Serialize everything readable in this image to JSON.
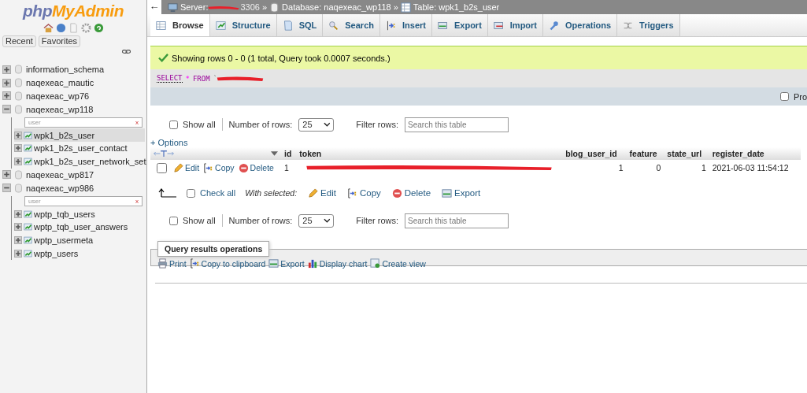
{
  "sidebar": {
    "logo": {
      "part_1": "php",
      "part_2": "MyAdmin"
    },
    "tabs": [
      {
        "label": "Recent"
      },
      {
        "label": "Favorites"
      }
    ],
    "databases": [
      {
        "name": "information_schema",
        "expanded": false
      },
      {
        "name": "naqexeac_mautic",
        "expanded": false
      },
      {
        "name": "naqexeac_wp76",
        "expanded": false
      },
      {
        "name": "naqexeac_wp118",
        "expanded": true,
        "filter": {
          "value": "user",
          "clear": "x"
        },
        "children": [
          {
            "name": "wpk1_b2s_user",
            "selected": true
          },
          {
            "name": "wpk1_b2s_user_contact",
            "selected": false
          },
          {
            "name": "wpk1_b2s_user_network_set",
            "selected": false
          }
        ]
      },
      {
        "name": "naqexeac_wp817",
        "expanded": false
      },
      {
        "name": "naqexeac_wp986",
        "expanded": true,
        "filter": {
          "value": "user",
          "clear": "x"
        },
        "children": [
          {
            "name": "wptp_tqb_users",
            "selected": false
          },
          {
            "name": "wptp_tqb_user_answers",
            "selected": false
          },
          {
            "name": "wptp_usermeta",
            "selected": false
          },
          {
            "name": "wptp_users",
            "selected": false
          }
        ]
      }
    ]
  },
  "breadcrumb": {
    "back": "←",
    "server_label": "Server:",
    "server_tail": "3306",
    "sep_1": "»",
    "database": "Database: naqexeac_wp118",
    "sep_2": "»",
    "table": "Table: wpk1_b2s_user"
  },
  "tabs": [
    {
      "label": "Browse",
      "selected": true
    },
    {
      "label": "Structure",
      "selected": false
    },
    {
      "label": "SQL",
      "selected": false
    },
    {
      "label": "Search",
      "selected": false
    },
    {
      "label": "Insert",
      "selected": false
    },
    {
      "label": "Export",
      "selected": false
    },
    {
      "label": "Import",
      "selected": false
    },
    {
      "label": "Operations",
      "selected": false
    },
    {
      "label": "Triggers",
      "selected": false
    }
  ],
  "message": "Showing rows 0 - 0 (1 total, Query took 0.0007 seconds.)",
  "sql": {
    "keyword_1": "SELECT",
    "star": "*",
    "keyword_2": "FROM",
    "quote": "`"
  },
  "profiling": {
    "label": "Pro",
    "checked": false
  },
  "navigation": [
    {
      "show_all": "Show all",
      "checked": false,
      "rows_label": "Number of rows:",
      "rows_value": "25",
      "filter_label": "Filter rows:",
      "filter_placeholder": "Search this table"
    },
    {
      "show_all": "Show all",
      "checked": false,
      "rows_label": "Number of rows:",
      "rows_value": "25",
      "filter_label": "Filter rows:",
      "filter_placeholder": "Search this table"
    }
  ],
  "options": "+ Options",
  "table": {
    "columns": [
      "id",
      "token",
      "blog_user_id",
      "feature",
      "state_url",
      "register_date"
    ],
    "rows": [
      {
        "checked": false,
        "edit": "Edit",
        "copy": "Copy",
        "delete": "Delete",
        "id": "1",
        "blog_user_id": "1",
        "feature": "0",
        "state_url": "1",
        "register_date": "2021-06-03 11:54:12"
      }
    ]
  },
  "bulk": {
    "check_all": "Check all",
    "checked": false,
    "with_selected": "With selected:",
    "actions": [
      {
        "kind": "edit",
        "label": "Edit"
      },
      {
        "kind": "copy",
        "label": "Copy"
      },
      {
        "kind": "delete",
        "label": "Delete"
      },
      {
        "kind": "export",
        "label": "Export"
      }
    ]
  },
  "query_ops": {
    "legend": "Query results operations",
    "actions": [
      {
        "kind": "print",
        "label": "Print"
      },
      {
        "kind": "copy",
        "label": "Copy to clipboard"
      },
      {
        "kind": "export",
        "label": "Export"
      },
      {
        "kind": "chart",
        "label": "Display chart"
      },
      {
        "kind": "view",
        "label": "Create view"
      }
    ]
  }
}
